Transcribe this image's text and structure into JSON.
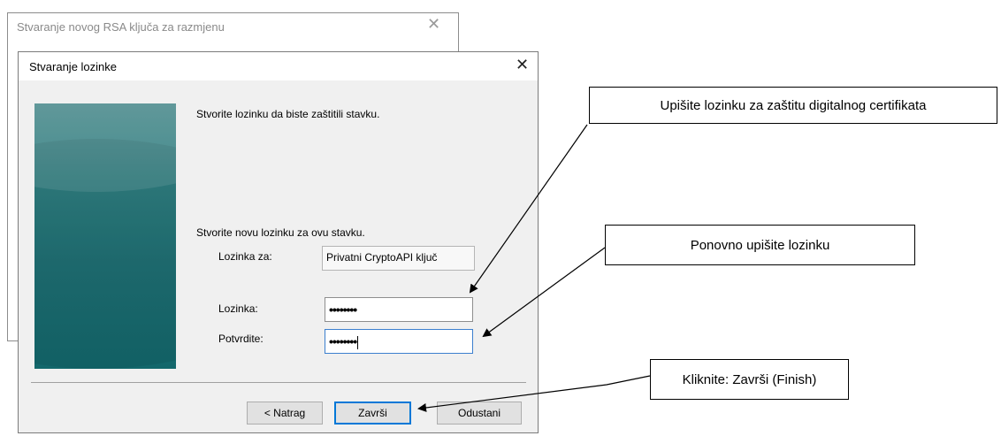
{
  "back_window": {
    "title": "Stvaranje novog RSA ključa za razmjenu",
    "close_glyph": "✕"
  },
  "dialog": {
    "title": "Stvaranje lozinke",
    "close_glyph": "✕",
    "intro": "Stvorite lozinku da biste zaštitili stavku.",
    "new_password_heading": "Stvorite novu lozinku za ovu stavku.",
    "password_for_label": "Lozinka za:",
    "password_for_value": "Privatni CryptoAPI ključ",
    "password_label": "Lozinka:",
    "password_value": "••••••••",
    "confirm_label": "Potvrdite:",
    "confirm_value": "••••••••",
    "buttons": {
      "back": "< Natrag",
      "finish": "Završi",
      "cancel": "Odustani"
    }
  },
  "callouts": {
    "enter_password": "Upišite lozinku za zaštitu digitalnog certifikata",
    "reenter_password": "Ponovno upišite lozinku",
    "click_finish": "Kliknite: Završi (Finish)"
  },
  "colors": {
    "side_panel": "#1f6f73",
    "focus_border": "#3c7fce",
    "default_button_border": "#0078d7"
  }
}
